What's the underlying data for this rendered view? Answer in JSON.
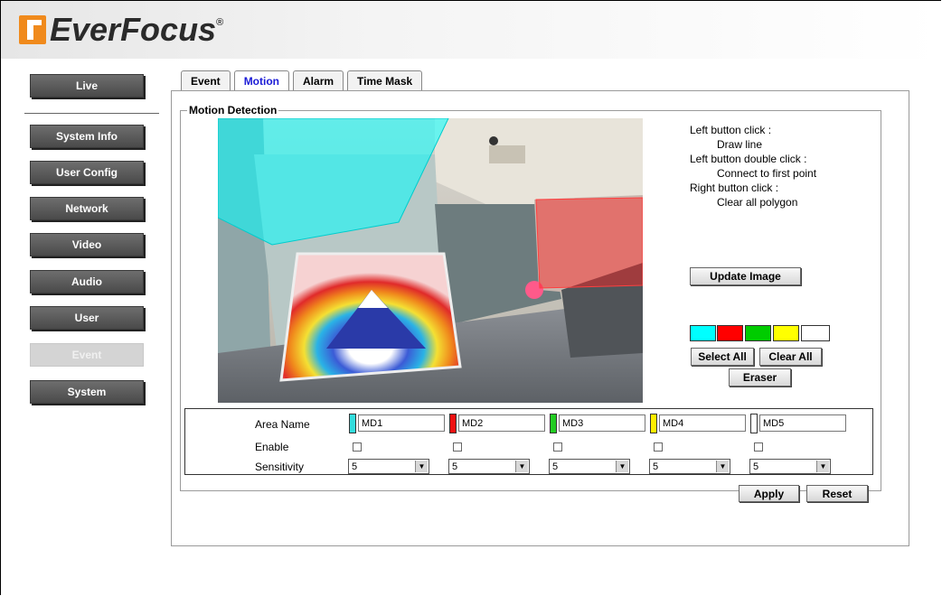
{
  "brand": {
    "name": "EverFocus",
    "reg": "®"
  },
  "sidebar": {
    "items": [
      {
        "label": "Live"
      },
      {
        "label": "System Info"
      },
      {
        "label": "User Config"
      },
      {
        "label": "Network"
      },
      {
        "label": "Video"
      },
      {
        "label": "Audio"
      },
      {
        "label": "User"
      },
      {
        "label": "Event"
      },
      {
        "label": "System"
      }
    ]
  },
  "tabs": [
    {
      "label": "Event"
    },
    {
      "label": "Motion"
    },
    {
      "label": "Alarm"
    },
    {
      "label": "Time Mask"
    }
  ],
  "motion": {
    "legend": "Motion Detection",
    "instructions": {
      "left_click": "Left button click :",
      "draw_line": "Draw line",
      "left_double": "Left button double click :",
      "connect": "Connect to first point",
      "right_click": "Right button click :",
      "clear_polygon": "Clear all polygon"
    },
    "update_image": "Update Image",
    "select_all": "Select All",
    "clear_all": "Clear All",
    "eraser": "Eraser",
    "swatches": [
      "#00ffff",
      "#ff0000",
      "#00cc00",
      "#ffff00",
      "#ffffff"
    ],
    "labels": {
      "area_name": "Area Name",
      "enable": "Enable",
      "sensitivity": "Sensitivity"
    },
    "areas": [
      {
        "name": "MD1",
        "color": "#33dddd",
        "sensitivity": "5"
      },
      {
        "name": "MD2",
        "color": "#ee1111",
        "sensitivity": "5"
      },
      {
        "name": "MD3",
        "color": "#22cc22",
        "sensitivity": "5"
      },
      {
        "name": "MD4",
        "color": "#ffee00",
        "sensitivity": "5"
      },
      {
        "name": "MD5",
        "color": "#ffffff",
        "sensitivity": "5"
      }
    ]
  },
  "footer": {
    "apply": "Apply",
    "reset": "Reset"
  }
}
